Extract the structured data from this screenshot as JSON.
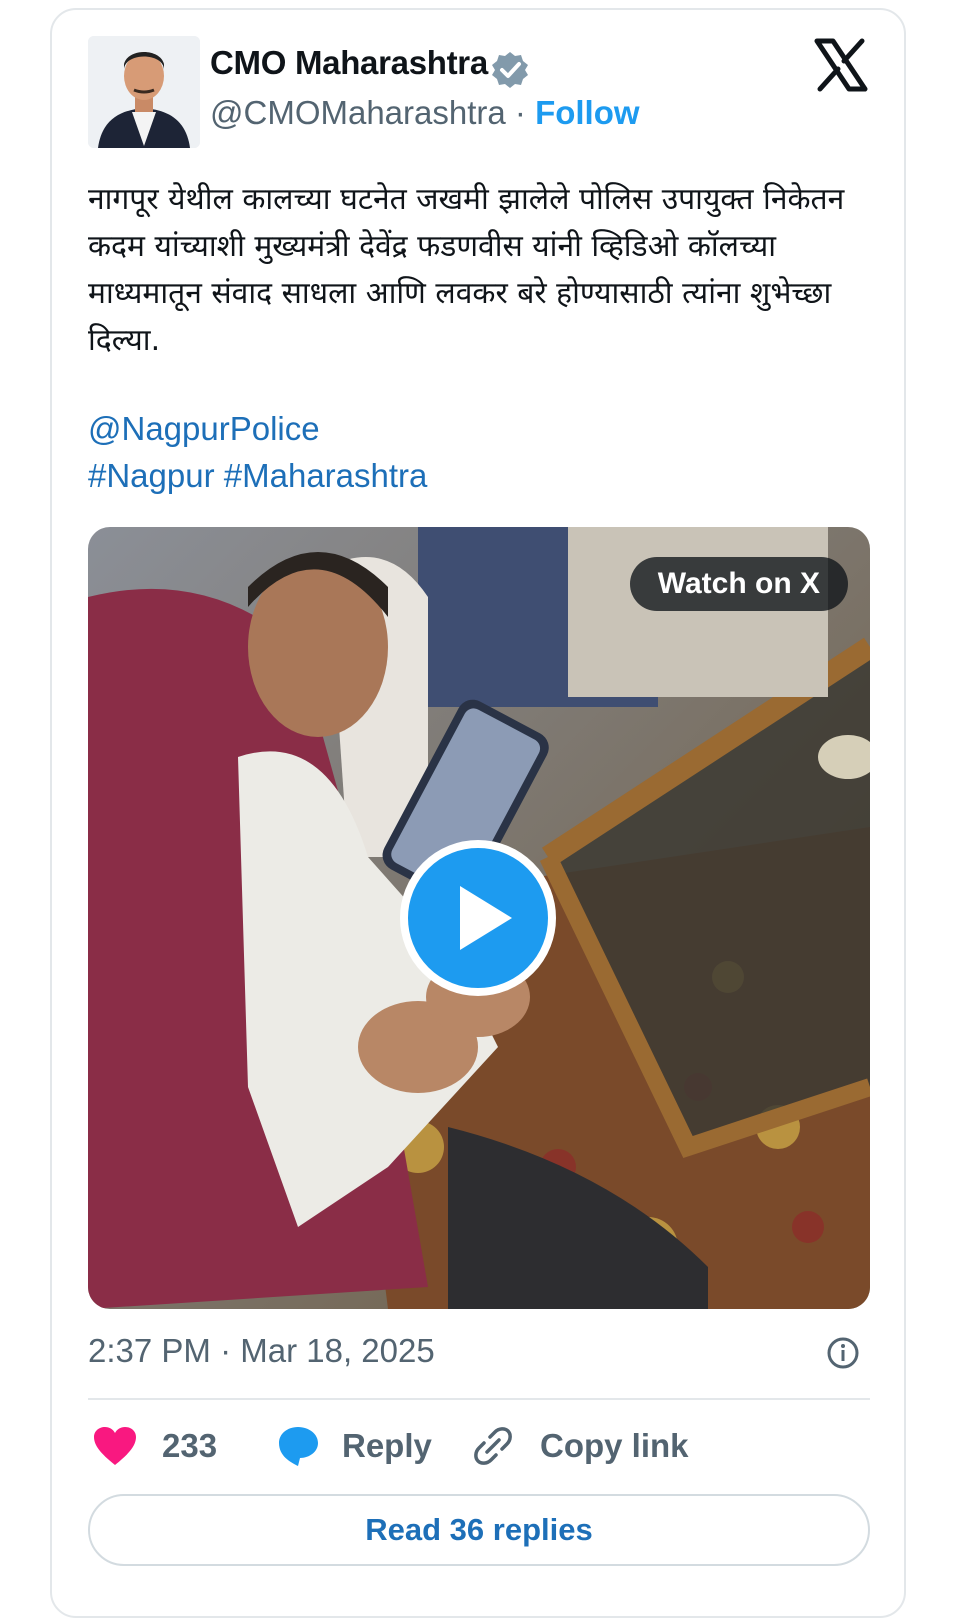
{
  "author": {
    "name": "CMO Maharashtra",
    "handle": "@CMOMaharashtra",
    "separator": " · ",
    "follow_label": "Follow"
  },
  "tweet": {
    "text": "नागपूर येथील कालच्या घटनेत जखमी झालेले पोलिस उपायुक्त निकेतन कदम यांच्याशी मुख्यमंत्री देवेंद्र फडणवीस यांनी व्हिडिओ कॉलच्या माध्यमातून संवाद साधला आणि लवकर बरे होण्यासाठी त्यांना शुभेच्छा दिल्या.",
    "mention": "@NagpurPolice",
    "hashtags": [
      "#Nagpur",
      "#Maharashtra"
    ]
  },
  "media": {
    "watch_label": "Watch on X"
  },
  "meta": {
    "time": "2:37 PM",
    "date": "Mar 18, 2025",
    "separator": " · "
  },
  "actions": {
    "likes": "233",
    "reply_label": "Reply",
    "copy_label": "Copy link"
  },
  "read_replies_label": "Read 36 replies",
  "colors": {
    "accent": "#1d9bf0",
    "link": "#1d6fb8",
    "like": "#f91880",
    "muted": "#536471"
  }
}
